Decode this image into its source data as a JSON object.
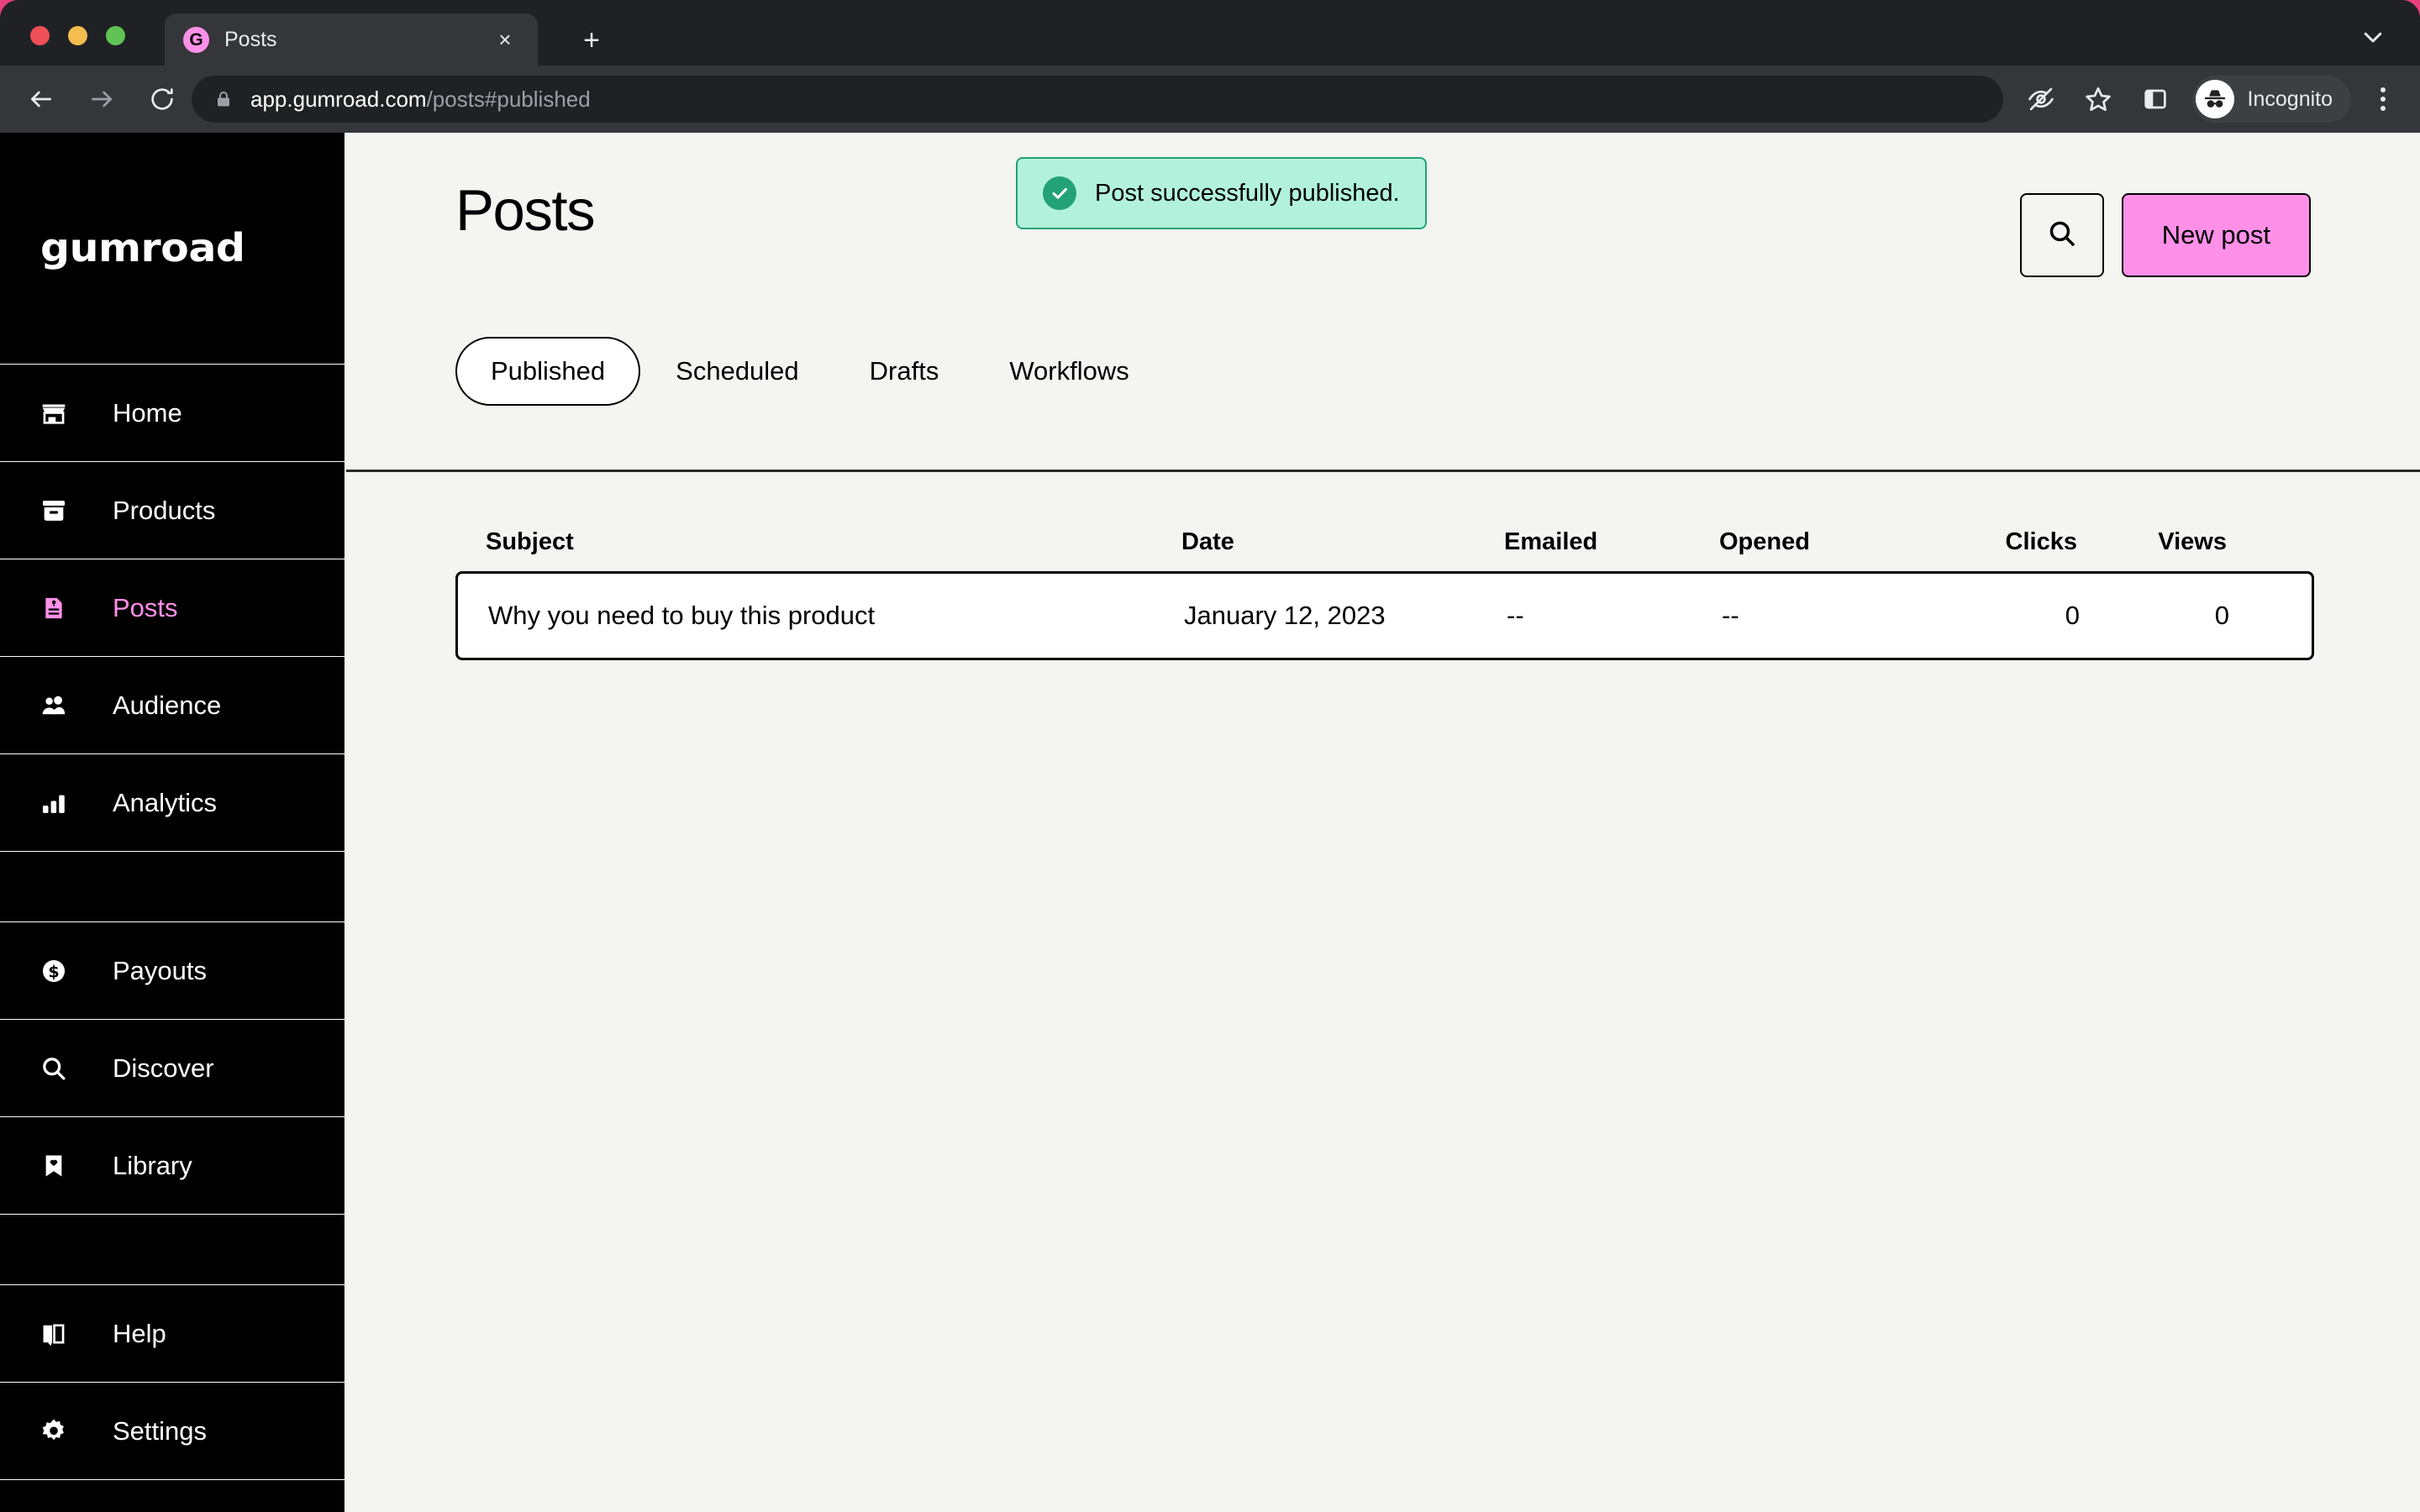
{
  "browser": {
    "tab": {
      "title": "Posts",
      "favicon_letter": "G",
      "favicon_color": "#ff90e8"
    },
    "new_tab_label": "+",
    "tab_close_label": "×",
    "omnibox": {
      "host": "app.gumroad.com",
      "path": "/posts#published",
      "full_url": "app.gumroad.com/posts#published"
    },
    "profile": {
      "label": "Incognito"
    },
    "icons": {
      "back": "back-arrow-icon",
      "forward": "forward-arrow-icon",
      "reload": "reload-icon",
      "lock": "lock-icon",
      "tabstrip_expand": "chevron-down-icon",
      "tracking_protection": "eye-slash-icon",
      "bookmark": "star-icon",
      "side_panel": "side-panel-icon",
      "menu": "three-dot-menu-icon"
    }
  },
  "sidebar": {
    "logo": "gumroad",
    "items": [
      {
        "label": "Home",
        "icon": "storefront-icon",
        "active": false
      },
      {
        "label": "Products",
        "icon": "archive-box-icon",
        "active": false
      },
      {
        "label": "Posts",
        "icon": "document-pin-icon",
        "active": true
      },
      {
        "label": "Audience",
        "icon": "people-icon",
        "active": false
      },
      {
        "label": "Analytics",
        "icon": "bar-chart-icon",
        "active": false
      },
      {
        "label": "Payouts",
        "icon": "dollar-circle-icon",
        "active": false
      },
      {
        "label": "Discover",
        "icon": "magnifier-icon",
        "active": false
      },
      {
        "label": "Library",
        "icon": "bookmark-heart-icon",
        "active": false
      },
      {
        "label": "Help",
        "icon": "open-book-icon",
        "active": false
      },
      {
        "label": "Settings",
        "icon": "gear-icon",
        "active": false
      }
    ],
    "active_color": "#ff90e8"
  },
  "page": {
    "title": "Posts",
    "toast": {
      "message": "Post successfully published.",
      "icon": "check-circle-icon",
      "background": "#b2f2dd",
      "border": "#23a277"
    },
    "search_button_icon": "search-icon",
    "new_post_label": "New post",
    "new_post_color": "#ff90e8",
    "tabs": [
      {
        "label": "Published",
        "active": true
      },
      {
        "label": "Scheduled",
        "active": false
      },
      {
        "label": "Drafts",
        "active": false
      },
      {
        "label": "Workflows",
        "active": false
      }
    ]
  },
  "table": {
    "columns": [
      "Subject",
      "Date",
      "Emailed",
      "Opened",
      "Clicks",
      "Views"
    ],
    "rows": [
      {
        "subject": "Why you need to buy this product",
        "date": "January 12, 2023",
        "emailed": "--",
        "opened": "--",
        "clicks": "0",
        "views": "0"
      }
    ]
  }
}
